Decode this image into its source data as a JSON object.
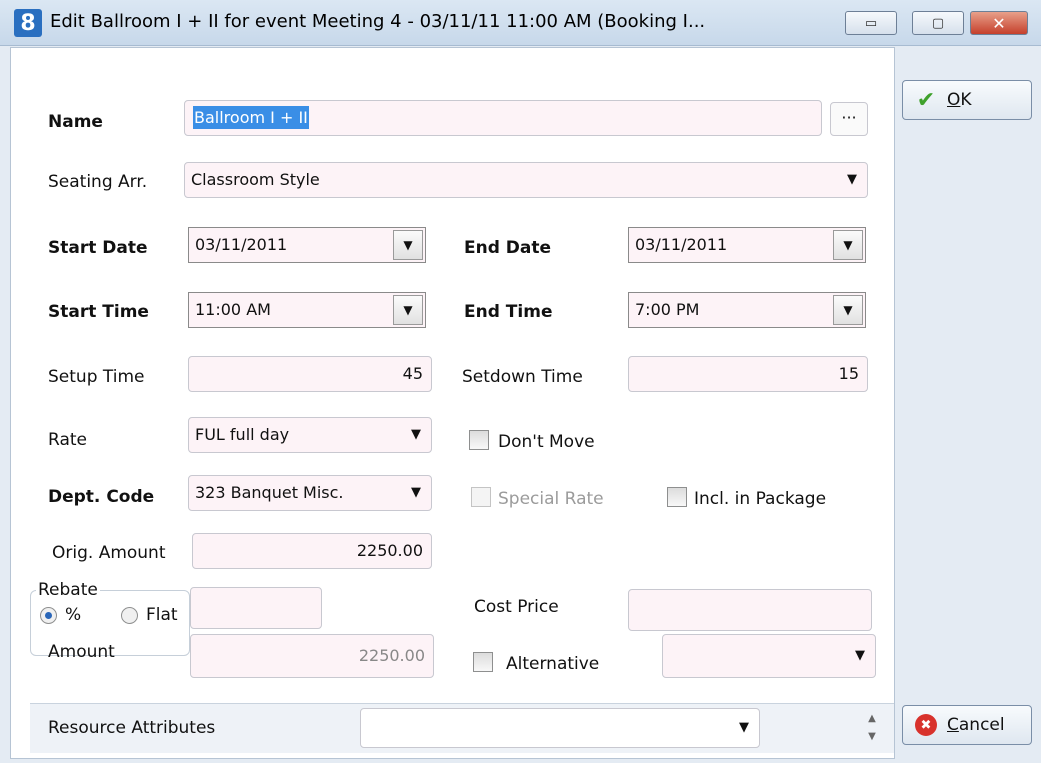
{
  "window": {
    "title": "Edit Ballroom I + II for event Meeting 4 - 03/11/11 11:00 AM (Booking I...",
    "app_icon_text": "8",
    "minimize_symbol": "▭",
    "maximize_symbol": "▢",
    "close_symbol": "✕"
  },
  "form": {
    "name_label": "Name",
    "name_value": "Ballroom I + II",
    "name_browse": "···",
    "seating_label": "Seating Arr.",
    "seating_value": "Classroom Style",
    "start_date_label": "Start Date",
    "start_date_value": "03/11/2011",
    "end_date_label": "End Date",
    "end_date_value": "03/11/2011",
    "start_time_label": "Start Time",
    "start_time_value": "11:00 AM",
    "end_time_label": "End Time",
    "end_time_value": "7:00 PM",
    "setup_label": "Setup Time",
    "setup_value": "45",
    "setdown_label": "Setdown Time",
    "setdown_value": "15",
    "rate_label": "Rate",
    "rate_value": "FUL full day",
    "dont_move_label": "Don't Move",
    "dept_label": "Dept. Code",
    "dept_value": "323  Banquet Misc.",
    "special_rate_label": "Special Rate",
    "incl_package_label": "Incl. in Package",
    "orig_amount_label": "Orig. Amount",
    "orig_amount_value": "2250.00",
    "rebate_label": "Rebate",
    "rebate_percent": "%",
    "rebate_flat": "Flat",
    "rebate_value": "",
    "cost_price_label": "Cost Price",
    "cost_price_value": "",
    "amount_label": "Amount",
    "amount_value": "2250.00",
    "alternative_label": "Alternative",
    "alternative_value": "",
    "resource_attr_label": "Resource Attributes",
    "resource_attr_value": ""
  },
  "buttons": {
    "ok_access": "O",
    "ok_rest": "K",
    "cancel_access": "C",
    "cancel_rest": "ancel"
  },
  "icons": {
    "dropdown": "▼",
    "ok_icon": "✔",
    "cancel_icon": "✖",
    "spin_up": "▲",
    "spin_down": "▼"
  }
}
